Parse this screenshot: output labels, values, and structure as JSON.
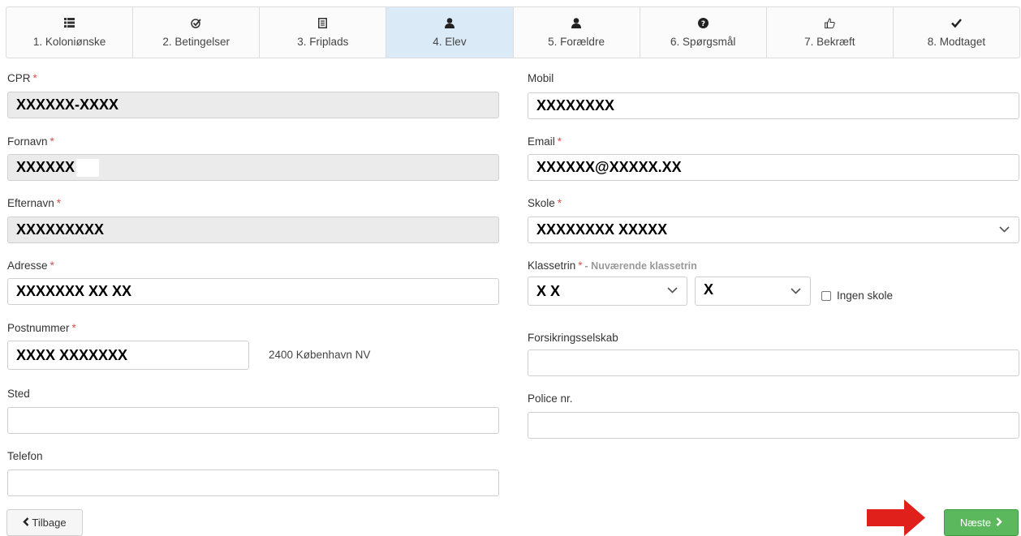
{
  "steps": [
    {
      "label": "1. Koloniønske",
      "icon": "list-icon"
    },
    {
      "label": "2. Betingelser",
      "icon": "check-circle-icon"
    },
    {
      "label": "3. Friplads",
      "icon": "document-icon"
    },
    {
      "label": "4. Elev",
      "icon": "user-icon",
      "active": true
    },
    {
      "label": "5. Forældre",
      "icon": "user-icon"
    },
    {
      "label": "6. Spørgsmål",
      "icon": "question-circle-icon"
    },
    {
      "label": "7. Bekræft",
      "icon": "thumbs-up-icon"
    },
    {
      "label": "8. Modtaget",
      "icon": "checkmark-icon"
    }
  ],
  "form": {
    "cpr": {
      "label": "CPR",
      "required": "*",
      "value": "XXXXXX-XXXX"
    },
    "fornavn": {
      "label": "Fornavn",
      "required": "*",
      "value": "XXXXXX"
    },
    "efternavn": {
      "label": "Efternavn",
      "required": "*",
      "value": "XXXXXXXXX"
    },
    "adresse": {
      "label": "Adresse",
      "required": "*",
      "value": "XXXXXXX XX XX"
    },
    "postnummer": {
      "label": "Postnummer",
      "required": "*",
      "value": "XXXX XXXXXXX",
      "city": "2400 København NV"
    },
    "sted": {
      "label": "Sted",
      "value": ""
    },
    "telefon": {
      "label": "Telefon",
      "value": ""
    },
    "mobil": {
      "label": "Mobil",
      "value": "XXXXXXXX"
    },
    "email": {
      "label": "Email",
      "required": "*",
      "value": "XXXXXX@XXXXX.XX"
    },
    "skole": {
      "label": "Skole",
      "required": "*",
      "value": "XXXXXXXX XXXXX"
    },
    "klassetrin": {
      "label": "Klassetrin",
      "required": "*",
      "hint": "- Nuværende klassetrin",
      "value1": "X X",
      "value2": "X",
      "no_school_label": "Ingen skole"
    },
    "forsikring": {
      "label": "Forsikringsselskab",
      "value": ""
    },
    "police": {
      "label": "Police nr.",
      "value": ""
    }
  },
  "buttons": {
    "back_label": "Tilbage",
    "next_label": "Næste"
  },
  "colors": {
    "active_tab": "#dbeaf7",
    "required": "#d9534f",
    "next_button": "#5cb85c",
    "arrow": "#e0201b"
  }
}
